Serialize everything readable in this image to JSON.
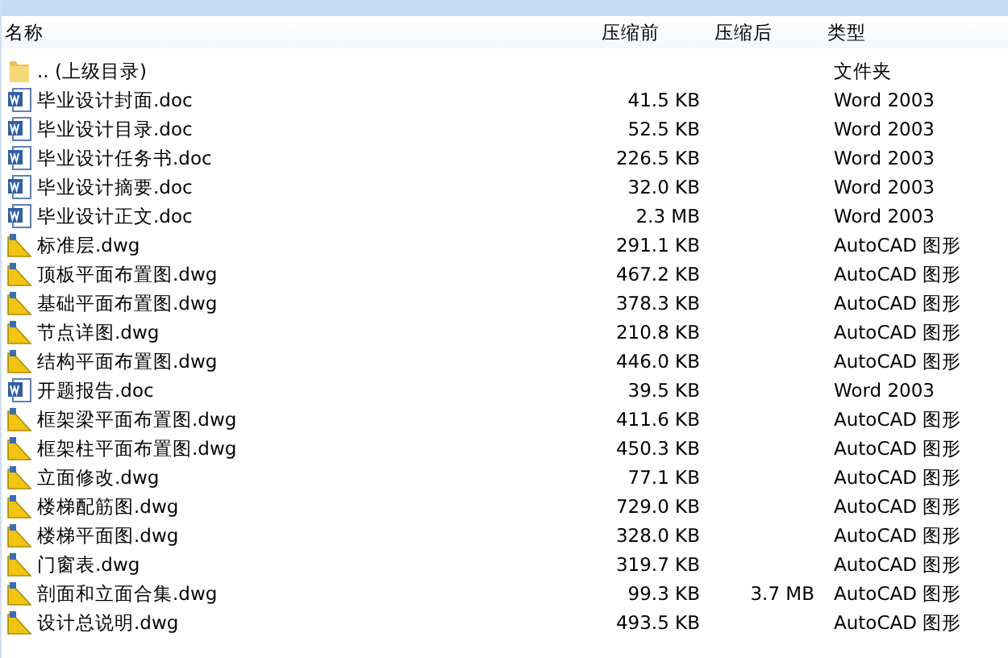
{
  "columns": [
    "名称",
    "压缩前",
    "压缩后",
    "类型"
  ],
  "rows": [
    {
      "kind": "folder",
      "name": ".. (上级目录)",
      "type": "文件夹"
    },
    {
      "kind": "doc",
      "name": "毕业设计封面.doc",
      "size": "41.5 KB",
      "type": "Word 2003"
    },
    {
      "kind": "doc",
      "name": "毕业设计目录.doc",
      "size": "52.5 KB",
      "type": "Word 2003"
    },
    {
      "kind": "doc",
      "name": "毕业设计任务书.doc",
      "size": "226.5 KB",
      "type": "Word 2003"
    },
    {
      "kind": "doc",
      "name": "毕业设计摘要.doc",
      "size": "32.0 KB",
      "type": "Word 2003"
    },
    {
      "kind": "doc",
      "name": "毕业设计正文.doc",
      "size": "2.3 MB",
      "type": "Word 2003"
    },
    {
      "kind": "dwg",
      "name": "标准层.dwg",
      "size": "291.1 KB",
      "type": "AutoCAD 图形"
    },
    {
      "kind": "dwg",
      "name": "顶板平面布置图.dwg",
      "size": "467.2 KB",
      "type": "AutoCAD 图形"
    },
    {
      "kind": "dwg",
      "name": "基础平面布置图.dwg",
      "size": "378.3 KB",
      "type": "AutoCAD 图形"
    },
    {
      "kind": "dwg",
      "name": "节点详图.dwg",
      "size": "210.8 KB",
      "type": "AutoCAD 图形"
    },
    {
      "kind": "dwg",
      "name": "结构平面布置图.dwg",
      "size": "446.0 KB",
      "type": "AutoCAD 图形"
    },
    {
      "kind": "doc",
      "name": "开题报告.doc",
      "size": "39.5 KB",
      "type": "Word 2003"
    },
    {
      "kind": "dwg",
      "name": "框架梁平面布置图.dwg",
      "size": "411.6 KB",
      "type": "AutoCAD 图形"
    },
    {
      "kind": "dwg",
      "name": "框架柱平面布置图.dwg",
      "size": "450.3 KB",
      "type": "AutoCAD 图形"
    },
    {
      "kind": "dwg",
      "name": "立面修改.dwg",
      "size": "77.1 KB",
      "type": "AutoCAD 图形"
    },
    {
      "kind": "dwg",
      "name": "楼梯配筋图.dwg",
      "size": "729.0 KB",
      "type": "AutoCAD 图形"
    },
    {
      "kind": "dwg",
      "name": "楼梯平面图.dwg",
      "size": "328.0 KB",
      "type": "AutoCAD 图形"
    },
    {
      "kind": "dwg",
      "name": "门窗表.dwg",
      "size": "319.7 KB",
      "type": "AutoCAD 图形"
    },
    {
      "kind": "dwg",
      "name": "剖面和立面合集.dwg",
      "size": "99.3 KB",
      "packed": "3.7 MB",
      "type": "AutoCAD 图形"
    },
    {
      "kind": "dwg",
      "name": "设计总说明.dwg",
      "size": "493.5 KB",
      "type": "AutoCAD 图形"
    }
  ]
}
